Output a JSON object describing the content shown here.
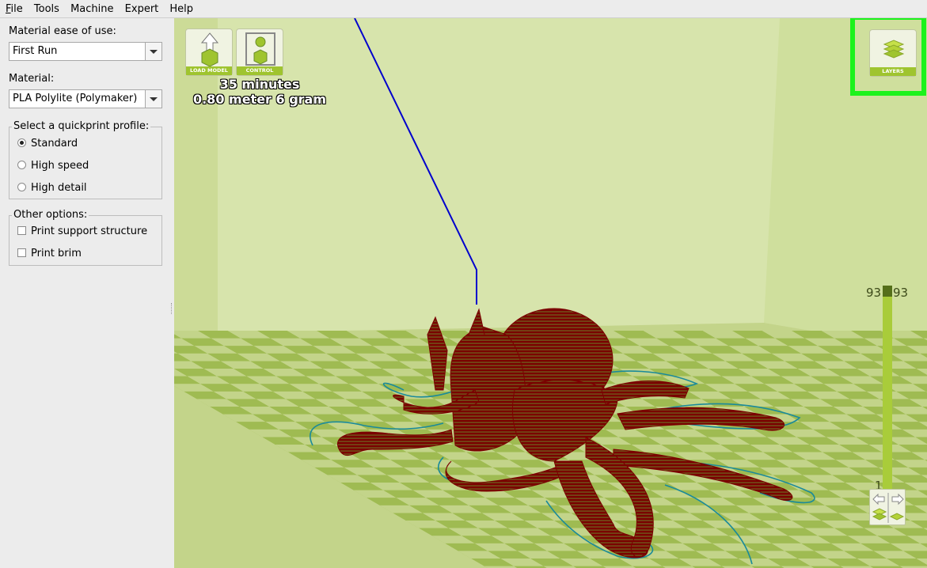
{
  "menubar": {
    "items": [
      {
        "mnemonic": "F",
        "rest": "ile"
      },
      {
        "mnemonic": "",
        "rest": "Tools"
      },
      {
        "mnemonic": "",
        "rest": "Machine"
      },
      {
        "mnemonic": "",
        "rest": "Expert"
      },
      {
        "mnemonic": "",
        "rest": "Help"
      }
    ]
  },
  "sidebar": {
    "ease_label": "Material ease of use:",
    "ease_value": "First Run",
    "material_label": "Material:",
    "material_value": "PLA Polylite (Polymaker)",
    "quickprint": {
      "title": "Select a quickprint profile:",
      "options": [
        {
          "label": "Standard",
          "selected": true
        },
        {
          "label": "High speed",
          "selected": false
        },
        {
          "label": "High detail",
          "selected": false
        }
      ]
    },
    "other": {
      "title": "Other options:",
      "options": [
        {
          "label": "Print support structure",
          "checked": false
        },
        {
          "label": "Print brim",
          "checked": false
        }
      ]
    }
  },
  "viewport": {
    "load_model_label": "LOAD MODEL",
    "control_label": "CONTROL",
    "layers_label": "LAYERS",
    "print_time": "35 minutes",
    "print_material": "0.80 meter 6 gram",
    "layer_current_left": "93",
    "layer_current_right": "93",
    "layer_min": "1",
    "colors": {
      "background": "#d7e4ac",
      "model": "#7a0000",
      "toolpath": "#0000cc",
      "outline": "#1a8a9a",
      "highlight": "#1cf21c"
    }
  }
}
